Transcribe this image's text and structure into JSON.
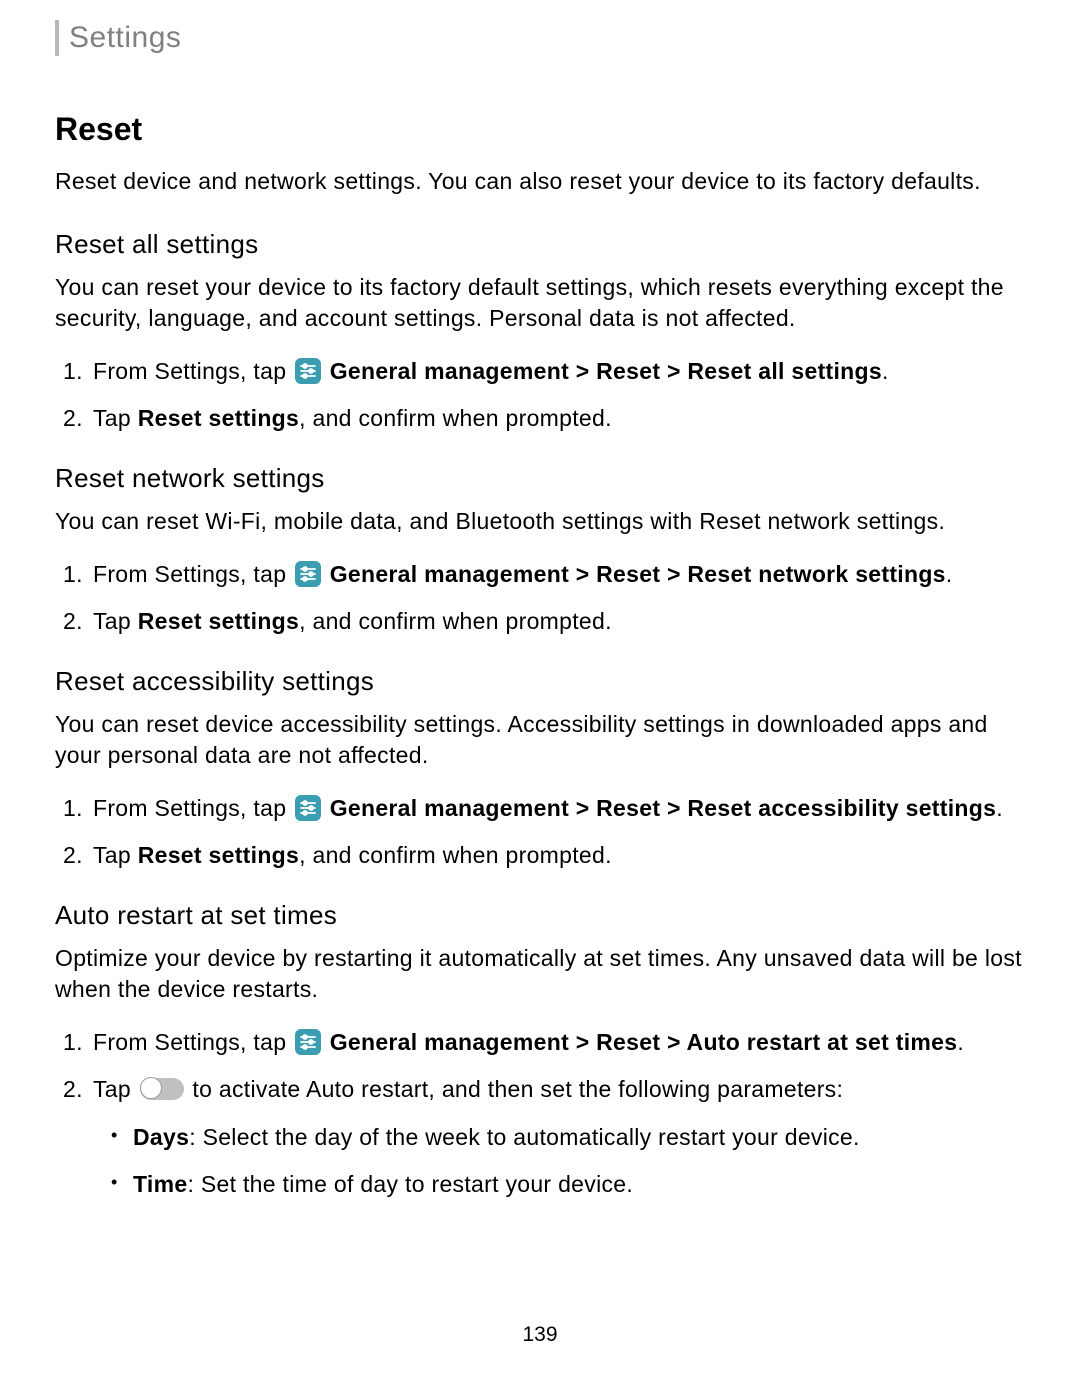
{
  "header": {
    "title": "Settings"
  },
  "main": {
    "heading": "Reset",
    "intro": "Reset device and network settings. You can also reset your device to its factory defaults."
  },
  "sections": {
    "reset_all": {
      "heading": "Reset all settings",
      "description": "You can reset your device to its factory default settings, which resets everything except the security, language, and account settings. Personal data is not affected.",
      "step1_prefix": "From Settings, tap ",
      "step1_bold": "General management > Reset > Reset all settings",
      "step1_suffix": ".",
      "step2_prefix": "Tap ",
      "step2_bold": "Reset settings",
      "step2_suffix": ", and confirm when prompted."
    },
    "reset_network": {
      "heading": "Reset network settings",
      "description": "You can reset Wi-Fi, mobile data, and Bluetooth settings with Reset network settings.",
      "step1_prefix": "From Settings, tap ",
      "step1_bold": "General management > Reset > Reset network settings",
      "step1_suffix": ".",
      "step2_prefix": "Tap ",
      "step2_bold": "Reset settings",
      "step2_suffix": ", and confirm when prompted."
    },
    "reset_accessibility": {
      "heading": "Reset accessibility settings",
      "description": "You can reset device accessibility settings. Accessibility settings in downloaded apps and your personal data are not affected.",
      "step1_prefix": "From Settings, tap ",
      "step1_bold": "General management > Reset > Reset accessibility settings",
      "step1_suffix": ".",
      "step2_prefix": "Tap ",
      "step2_bold": "Reset settings",
      "step2_suffix": ", and confirm when prompted."
    },
    "auto_restart": {
      "heading": "Auto restart at set times",
      "description": "Optimize your device by restarting it automatically at set times. Any unsaved data will be lost when the device restarts.",
      "step1_prefix": "From Settings, tap ",
      "step1_bold": "General management > Reset > Auto restart at set times",
      "step1_suffix": ".",
      "step2_prefix": "Tap ",
      "step2_suffix": " to activate Auto restart, and then set the following parameters:",
      "bullets": {
        "days_label": "Days",
        "days_text": ": Select the day of the week to automatically restart your device.",
        "time_label": "Time",
        "time_text": ": Set the time of day to restart your device."
      }
    }
  },
  "list_numbers": {
    "one": "1.",
    "two": "2."
  },
  "bullet_char": "•",
  "page_number": "139"
}
